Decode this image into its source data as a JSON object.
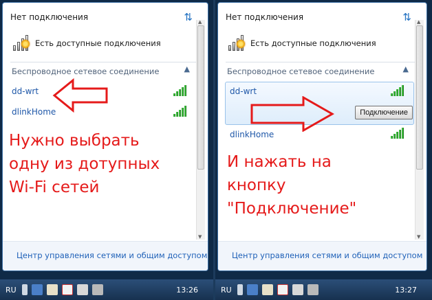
{
  "left": {
    "title": "Нет подключения",
    "available": "Есть доступные подключения",
    "section": "Беспроводное сетевое соединение",
    "networks": [
      "dd-wrt",
      "dlinkHome"
    ],
    "note_lines": [
      "Нужно выбрать",
      "одну из дотупных",
      "Wi-Fi сетей"
    ],
    "footer": "Центр управления сетями и общим доступом",
    "lang": "RU",
    "time": "13:26"
  },
  "right": {
    "title": "Нет подключения",
    "available": "Есть доступные подключения",
    "section": "Беспроводное сетевое соединение",
    "networks": [
      "dd-wrt",
      "dlinkHome"
    ],
    "connect_button": "Подключение",
    "note_lines": [
      "И нажать на",
      "кнопку",
      "\"Подключение\""
    ],
    "footer": "Центр управления сетями и общим доступом",
    "lang": "RU",
    "time": "13:27"
  },
  "colors": {
    "arrow": "#e51a1a",
    "link": "#1e57a8"
  }
}
